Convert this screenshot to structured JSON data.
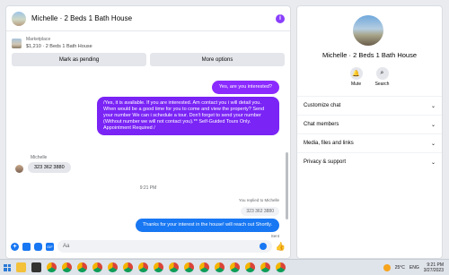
{
  "chat": {
    "title": "Michelle · 2 Beds 1 Bath House",
    "listing_source": "Marketplace",
    "listing_name": "$1,210 · 2 Beds 1 Bath House",
    "mark_pending_label": "Mark as pending",
    "more_options_label": "More options",
    "messages": {
      "out1": "Yes, are you interested?",
      "out2": "/Yes, it is available. If you are interested.  Am contact you i will detail you.  When would be a good time for you to come and view the property? Send your number We can i schedule a tour.  Don't forget to send your number (Without number we will not contact you).** Self-Guided Tours Only. Appointment Required /",
      "sender_name": "Michelle",
      "in1": "323 362 3880",
      "timestamp": "9:21 PM",
      "replied_label": "You replied to Michelle",
      "quoted": "323 362 3880",
      "out3": "Thanks for your interest in the house! will reach out Shortly.",
      "status": "Sent"
    },
    "composer_placeholder": "Aa"
  },
  "info": {
    "name": "Michelle · 2 Beds 1 Bath House",
    "mute_label": "Mute",
    "search_label": "Search",
    "sections": [
      "Customize chat",
      "Chat members",
      "Media, files and links",
      "Privacy & support"
    ]
  },
  "taskbar": {
    "temperature": "25°C",
    "language": "ENG",
    "time": "9:21 PM",
    "date": "3/27/2023"
  },
  "colors": {
    "purple_bubble": "#8b2bff",
    "blue_bubble": "#1877f2",
    "accent": "#8a3ffc"
  }
}
